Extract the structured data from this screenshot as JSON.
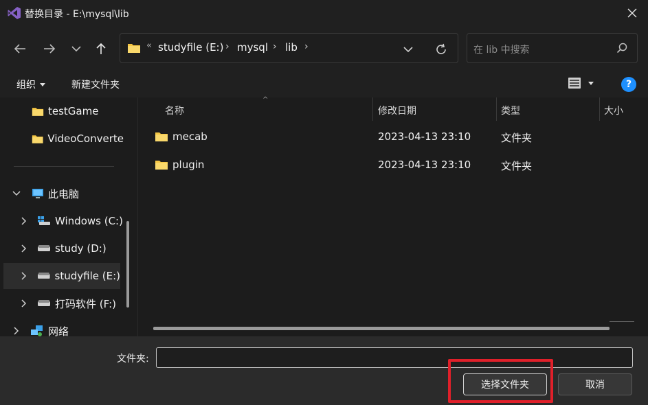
{
  "window": {
    "title": "替换目录 - E:\\mysql\\lib"
  },
  "nav": {
    "overflow": "«",
    "breadcrumbs": [
      "studyfile (E:)",
      "mysql",
      "lib"
    ],
    "search_placeholder": "在 lib 中搜索"
  },
  "toolbar": {
    "organize_label": "组织",
    "new_folder_label": "新建文件夹",
    "help_label": "?"
  },
  "sidebar": {
    "items": [
      {
        "label": "testGame",
        "icon": "folder-icon"
      },
      {
        "label": "VideoConverte",
        "icon": "folder-icon"
      },
      {
        "label": "此电脑",
        "icon": "computer-icon"
      },
      {
        "label": "Windows (C:)",
        "icon": "windows-drive-icon"
      },
      {
        "label": "study (D:)",
        "icon": "drive-icon"
      },
      {
        "label": "studyfile (E:)",
        "icon": "drive-icon",
        "selected": true
      },
      {
        "label": "打码软件 (F:)",
        "icon": "drive-icon"
      },
      {
        "label": "网络",
        "icon": "network-icon"
      }
    ]
  },
  "columns": {
    "name": "名称",
    "modified": "修改日期",
    "type": "类型",
    "size": "大小"
  },
  "files": [
    {
      "name": "mecab",
      "modified": "2023-04-13 23:10",
      "type": "文件夹"
    },
    {
      "name": "plugin",
      "modified": "2023-04-13 23:10",
      "type": "文件夹"
    }
  ],
  "footer": {
    "folder_label": "文件夹:",
    "folder_value": "",
    "select_button": "选择文件夹",
    "cancel_button": "取消"
  },
  "colors": {
    "accent": "#1e90ff",
    "highlight": "#e0202a",
    "folder": "#f4c542"
  }
}
